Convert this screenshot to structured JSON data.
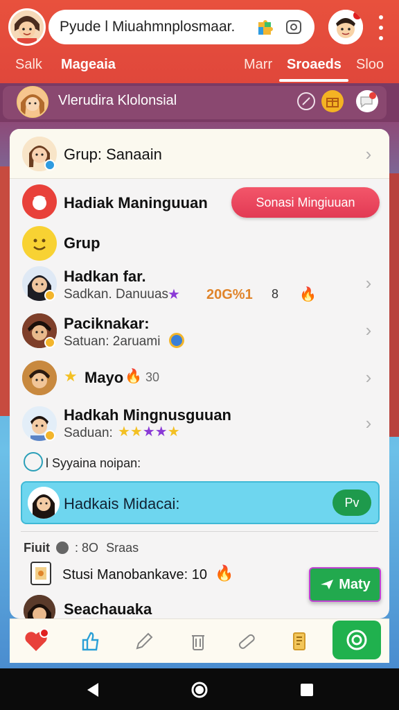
{
  "header": {
    "search_text": "Pyude l Miuahmnplosmaar.",
    "tabs": [
      {
        "label": "Salk"
      },
      {
        "label": "Mageaia"
      },
      {
        "label": "Marr"
      },
      {
        "label": "Sroaeds"
      },
      {
        "label": "Sloo"
      }
    ],
    "active_tab_index": 3
  },
  "profile_strip": {
    "name": "Vlerudira Klolonsial"
  },
  "card": {
    "group_row": {
      "title": "Grup: Sanaain"
    },
    "hadiak_row": {
      "title": "Hadiak Maninguuan",
      "action_label": "Sonasi Mingiuuan"
    },
    "grup_row": {
      "title": "Grup"
    },
    "contacts": [
      {
        "title": "Hadkan far.",
        "subtitle": "Sadkan. Danuuas",
        "meta": "20G%1",
        "meta2": "8"
      },
      {
        "title": "Paciknakar:",
        "subtitle": "Satuan: 2aruami"
      },
      {
        "title": "Mayo",
        "meta": "30"
      },
      {
        "title": "Hadkah Mingnusguuan",
        "subtitle": "Saduan:"
      }
    ],
    "section_label": "l Syyaina noipan:",
    "highlight": {
      "title": "Hadkais Midacai:",
      "pill_label": "Pv"
    },
    "freq": {
      "label": "Fiuit",
      "value": ": 8O",
      "unit": "Sraas"
    },
    "row_bottom": {
      "title": "Stusi Manobankave: 10"
    },
    "green_button": {
      "label": "Maty"
    },
    "last_row": {
      "title": "Seachauaka"
    }
  },
  "colors": {
    "header_red": "#e8513d",
    "strip_purple": "#7a3a64",
    "accent_pink": "#e23a54",
    "highlight_cyan": "#6ed6ef",
    "green": "#20b14e"
  }
}
